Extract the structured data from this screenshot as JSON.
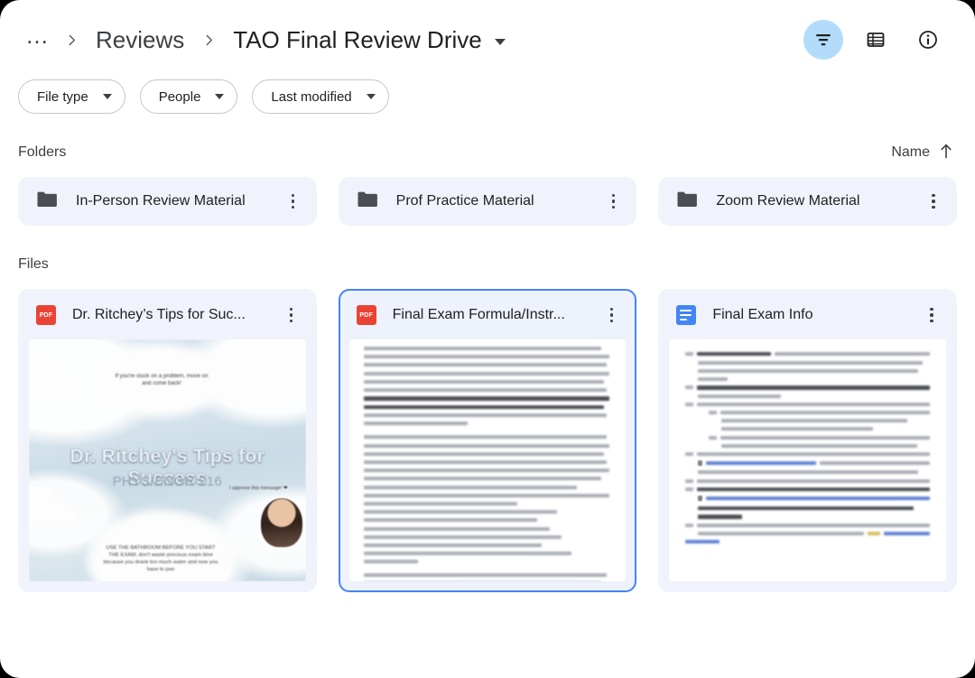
{
  "header": {
    "breadcrumb": {
      "overflow": "…",
      "parent": "Reviews",
      "current": "TAO Final Review Drive"
    },
    "actions": [
      {
        "name": "filter-icon",
        "label": "Filter",
        "active": true,
        "accent": "#b3dcfb"
      },
      {
        "name": "list-view-icon",
        "label": "List view",
        "active": false
      },
      {
        "name": "info-icon",
        "label": "Details",
        "active": false
      }
    ]
  },
  "filters": [
    {
      "label": "File type"
    },
    {
      "label": "People"
    },
    {
      "label": "Last modified"
    }
  ],
  "folders_section": {
    "title": "Folders",
    "sort": {
      "label": "Name",
      "direction": "ascending",
      "arrow": "↑"
    },
    "items": [
      {
        "name": "In-Person Review Material"
      },
      {
        "name": "Prof Practice Material"
      },
      {
        "name": "Zoom Review Material"
      }
    ]
  },
  "files_section": {
    "title": "Files",
    "items": [
      {
        "name": "Dr. Ritchey’s Tips for Suc...",
        "type": "pdf",
        "type_label": "PDF",
        "selected": false,
        "thumbnail": {
          "kind": "slide",
          "title": "Dr. Ritchey's Tips for Success",
          "subtitle": "PHYS/ENGR 216",
          "bubbles": [
            "If you're stuck on a problem, move on and come back!",
            "USE THE BATHROOM BEFORE YOU START THE EXAM, don't waste precious exam time because you drank too much water and now you have to pee"
          ],
          "approve_note": "I approve this message! ❤"
        }
      },
      {
        "name": "Final Exam Formula/Instr...",
        "type": "pdf",
        "type_label": "PDF",
        "selected": true,
        "thumbnail": {
          "kind": "text-document"
        }
      },
      {
        "name": "Final Exam Info",
        "type": "doc",
        "type_label": "Google Doc",
        "selected": false,
        "thumbnail": {
          "kind": "numbered-document"
        }
      }
    ]
  },
  "colors": {
    "page_background": "#ffffff",
    "card_background": "#f0f3fb",
    "selected_border": "#4285f4",
    "filter_active_bg": "#b3dcfb",
    "pdf_red": "#ea4335",
    "doc_blue": "#4285f4",
    "text_primary": "#202124",
    "text_secondary": "#3c4043"
  }
}
